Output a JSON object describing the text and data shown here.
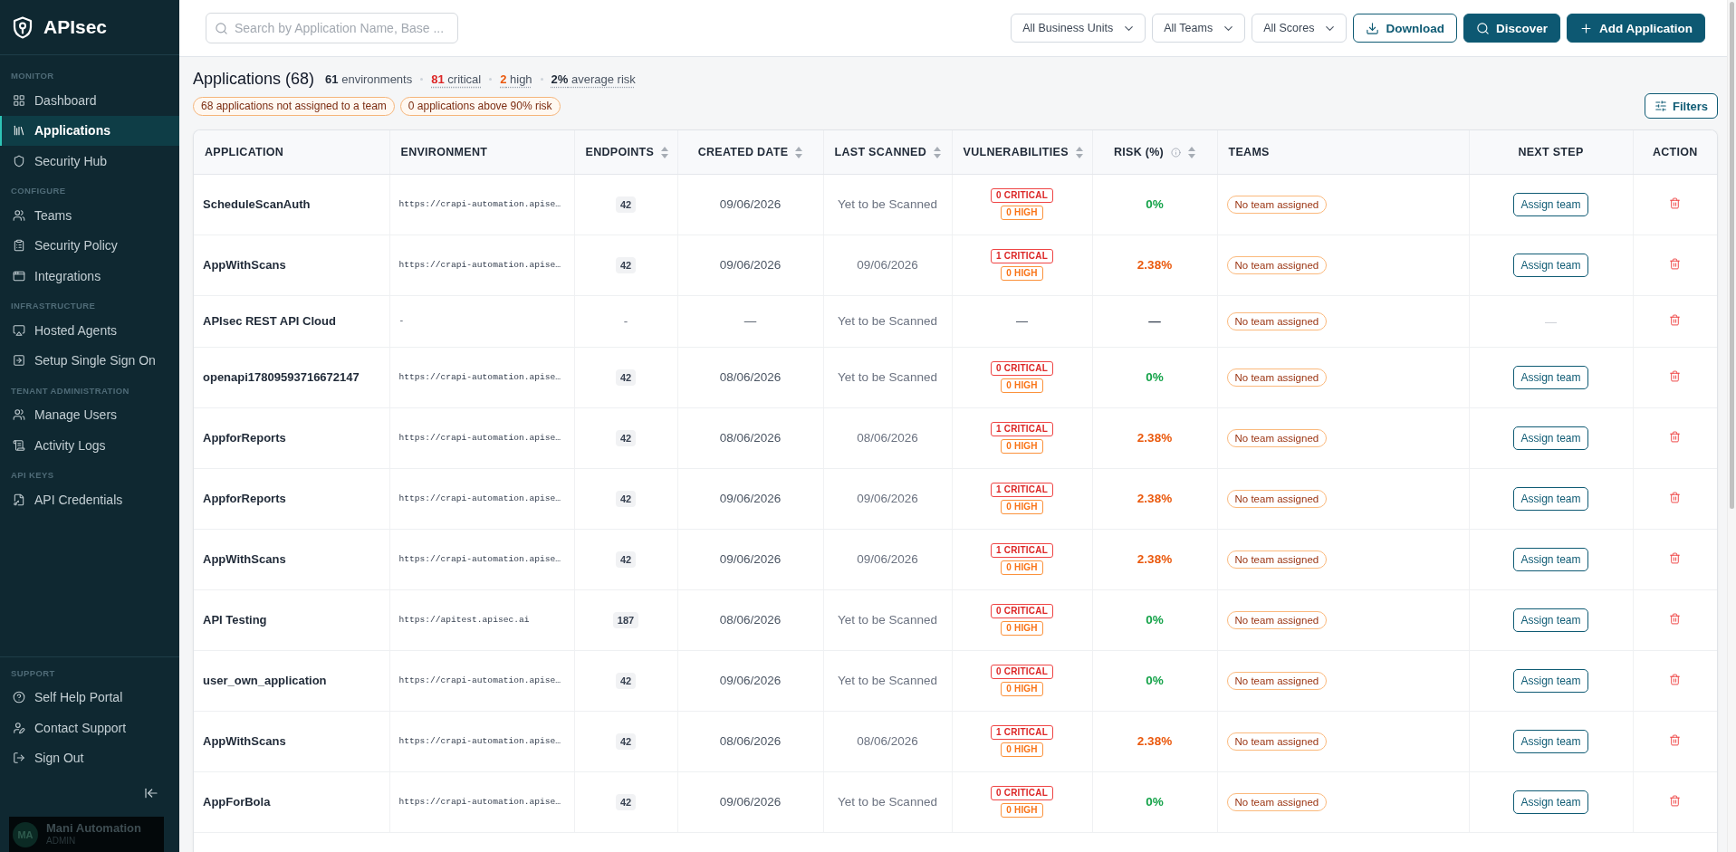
{
  "sidebar": {
    "brand": "APIsec",
    "sections": [
      {
        "title": "MONITOR",
        "items": [
          {
            "label": "Dashboard",
            "selected": false
          },
          {
            "label": "Applications",
            "selected": true
          },
          {
            "label": "Security Hub",
            "selected": false
          }
        ]
      },
      {
        "title": "CONFIGURE",
        "items": [
          {
            "label": "Teams",
            "selected": false
          },
          {
            "label": "Security Policy",
            "selected": false
          },
          {
            "label": "Integrations",
            "selected": false
          }
        ]
      },
      {
        "title": "INFRASTRUCTURE",
        "items": [
          {
            "label": "Hosted Agents",
            "selected": false
          },
          {
            "label": "Setup Single Sign On",
            "selected": false
          }
        ]
      },
      {
        "title": "TENANT ADMINISTRATION",
        "items": [
          {
            "label": "Manage Users",
            "selected": false
          },
          {
            "label": "Activity Logs",
            "selected": false
          }
        ]
      },
      {
        "title": "API KEYS",
        "items": [
          {
            "label": "API Credentials",
            "selected": false
          }
        ]
      }
    ],
    "support": {
      "title": "SUPPORT",
      "items": [
        {
          "label": "Self Help Portal",
          "selected": false
        },
        {
          "label": "Contact Support",
          "selected": false
        },
        {
          "label": "Sign Out",
          "selected": false
        }
      ]
    },
    "user": {
      "initials": "MA",
      "name": "Mani Automation",
      "role": "ADMIN"
    }
  },
  "top_bar": {
    "search": {
      "placeholder": "Search by Application Name, Base ..."
    },
    "dropdowns": [
      {
        "value": "All Business Units"
      },
      {
        "value": "All Teams"
      },
      {
        "value": "All Scores"
      }
    ],
    "buttons": [
      {
        "label": "Download",
        "kind": "outline"
      },
      {
        "label": "Discover",
        "kind": "primary"
      },
      {
        "label": "Add Application",
        "kind": "primary"
      }
    ]
  },
  "summary": {
    "title": "Applications (68)",
    "stats": [
      {
        "number": "61",
        "caption": "environments",
        "color": "#1f2937",
        "kind": "plain"
      },
      {
        "number": "81",
        "caption": "critical",
        "color": "#dc2626",
        "kind": "hint"
      },
      {
        "number": "2",
        "caption": "high",
        "color": "#ea580c",
        "kind": "hint"
      },
      {
        "number": "2%",
        "caption": "average risk",
        "color": "#1f2937",
        "kind": "hint"
      }
    ],
    "alerts": [
      "68 applications not assigned to a team",
      "0 applications above 90% risk"
    ],
    "filters_button": "Filters"
  },
  "table": {
    "columns": [
      {
        "label": "APPLICATION",
        "sortable": false,
        "info": false
      },
      {
        "label": "ENVIRONMENT",
        "sortable": false,
        "info": false
      },
      {
        "label": "ENDPOINTS",
        "sortable": true,
        "info": false
      },
      {
        "label": "CREATED DATE",
        "sortable": true,
        "info": false
      },
      {
        "label": "LAST SCANNED",
        "sortable": true,
        "info": false
      },
      {
        "label": "VULNERABILITIES",
        "sortable": true,
        "info": false
      },
      {
        "label": "RISK (%)",
        "sortable": true,
        "info": true
      },
      {
        "label": "TEAMS",
        "sortable": false,
        "info": false
      },
      {
        "label": "NEXT STEP",
        "sortable": false,
        "info": false
      },
      {
        "label": "ACTION",
        "sortable": false,
        "info": false
      }
    ],
    "rows": [
      {
        "application": "ScheduleScanAuth",
        "environment": "https://crapi-automation.apise…",
        "endpoints": {
          "kind": "badge",
          "text": "42"
        },
        "created": "09/06/2026",
        "last_scanned": "Yet to be Scanned",
        "vulnerabilities": [
          {
            "kind": "critical",
            "label": "0 CRITICAL"
          },
          {
            "kind": "high",
            "label": "0 HIGH"
          }
        ],
        "risk": {
          "text": "0%",
          "color": "#16a34a"
        },
        "team": "No team assigned",
        "next_step": {
          "kind": "button",
          "label": "Assign team"
        }
      },
      {
        "application": "AppWithScans",
        "environment": "https://crapi-automation.apise…",
        "endpoints": {
          "kind": "badge",
          "text": "42"
        },
        "created": "09/06/2026",
        "last_scanned": "09/06/2026",
        "vulnerabilities": [
          {
            "kind": "critical",
            "label": "1 CRITICAL"
          },
          {
            "kind": "high",
            "label": "0 HIGH"
          }
        ],
        "risk": {
          "text": "2.38%",
          "color": "#ea580c"
        },
        "team": "No team assigned",
        "next_step": {
          "kind": "button",
          "label": "Assign team"
        }
      },
      {
        "application": "APIsec REST API Cloud",
        "environment": "-",
        "endpoints": {
          "kind": "plain",
          "text": "-"
        },
        "created": "—",
        "last_scanned": "Yet to be Scanned",
        "vulnerabilities": [
          {
            "kind": "none",
            "label": "—"
          }
        ],
        "risk": {
          "text": "—",
          "color": "#374151"
        },
        "team": "No team assigned",
        "next_step": {
          "kind": "none",
          "label": "—"
        }
      },
      {
        "application": "openapi17809593716672147",
        "environment": "https://crapi-automation.apise…",
        "endpoints": {
          "kind": "badge",
          "text": "42"
        },
        "created": "08/06/2026",
        "last_scanned": "Yet to be Scanned",
        "vulnerabilities": [
          {
            "kind": "critical",
            "label": "0 CRITICAL"
          },
          {
            "kind": "high",
            "label": "0 HIGH"
          }
        ],
        "risk": {
          "text": "0%",
          "color": "#16a34a"
        },
        "team": "No team assigned",
        "next_step": {
          "kind": "button",
          "label": "Assign team"
        }
      },
      {
        "application": "AppforReports",
        "environment": "https://crapi-automation.apise…",
        "endpoints": {
          "kind": "badge",
          "text": "42"
        },
        "created": "08/06/2026",
        "last_scanned": "08/06/2026",
        "vulnerabilities": [
          {
            "kind": "critical",
            "label": "1 CRITICAL"
          },
          {
            "kind": "high",
            "label": "0 HIGH"
          }
        ],
        "risk": {
          "text": "2.38%",
          "color": "#ea580c"
        },
        "team": "No team assigned",
        "next_step": {
          "kind": "button",
          "label": "Assign team"
        }
      },
      {
        "application": "AppforReports",
        "environment": "https://crapi-automation.apise…",
        "endpoints": {
          "kind": "badge",
          "text": "42"
        },
        "created": "09/06/2026",
        "last_scanned": "09/06/2026",
        "vulnerabilities": [
          {
            "kind": "critical",
            "label": "1 CRITICAL"
          },
          {
            "kind": "high",
            "label": "0 HIGH"
          }
        ],
        "risk": {
          "text": "2.38%",
          "color": "#ea580c"
        },
        "team": "No team assigned",
        "next_step": {
          "kind": "button",
          "label": "Assign team"
        }
      },
      {
        "application": "AppWithScans",
        "environment": "https://crapi-automation.apise…",
        "endpoints": {
          "kind": "badge",
          "text": "42"
        },
        "created": "09/06/2026",
        "last_scanned": "09/06/2026",
        "vulnerabilities": [
          {
            "kind": "critical",
            "label": "1 CRITICAL"
          },
          {
            "kind": "high",
            "label": "0 HIGH"
          }
        ],
        "risk": {
          "text": "2.38%",
          "color": "#ea580c"
        },
        "team": "No team assigned",
        "next_step": {
          "kind": "button",
          "label": "Assign team"
        }
      },
      {
        "application": "API Testing",
        "environment": "https://apitest.apisec.ai",
        "endpoints": {
          "kind": "badge",
          "text": "187"
        },
        "created": "08/06/2026",
        "last_scanned": "Yet to be Scanned",
        "vulnerabilities": [
          {
            "kind": "critical",
            "label": "0 CRITICAL"
          },
          {
            "kind": "high",
            "label": "0 HIGH"
          }
        ],
        "risk": {
          "text": "0%",
          "color": "#16a34a"
        },
        "team": "No team assigned",
        "next_step": {
          "kind": "button",
          "label": "Assign team"
        }
      },
      {
        "application": "user_own_application",
        "environment": "https://crapi-automation.apise…",
        "endpoints": {
          "kind": "badge",
          "text": "42"
        },
        "created": "09/06/2026",
        "last_scanned": "Yet to be Scanned",
        "vulnerabilities": [
          {
            "kind": "critical",
            "label": "0 CRITICAL"
          },
          {
            "kind": "high",
            "label": "0 HIGH"
          }
        ],
        "risk": {
          "text": "0%",
          "color": "#16a34a"
        },
        "team": "No team assigned",
        "next_step": {
          "kind": "button",
          "label": "Assign team"
        }
      },
      {
        "application": "AppWithScans",
        "environment": "https://crapi-automation.apise…",
        "endpoints": {
          "kind": "badge",
          "text": "42"
        },
        "created": "08/06/2026",
        "last_scanned": "08/06/2026",
        "vulnerabilities": [
          {
            "kind": "critical",
            "label": "1 CRITICAL"
          },
          {
            "kind": "high",
            "label": "0 HIGH"
          }
        ],
        "risk": {
          "text": "2.38%",
          "color": "#ea580c"
        },
        "team": "No team assigned",
        "next_step": {
          "kind": "button",
          "label": "Assign team"
        }
      },
      {
        "application": "AppForBola",
        "environment": "https://crapi-automation.apise…",
        "endpoints": {
          "kind": "badge",
          "text": "42"
        },
        "created": "09/06/2026",
        "last_scanned": "Yet to be Scanned",
        "vulnerabilities": [
          {
            "kind": "critical",
            "label": "0 CRITICAL"
          },
          {
            "kind": "high",
            "label": "0 HIGH"
          }
        ],
        "risk": {
          "text": "0%",
          "color": "#16a34a"
        },
        "team": "No team assigned",
        "next_step": {
          "kind": "button",
          "label": "Assign team"
        }
      }
    ]
  }
}
